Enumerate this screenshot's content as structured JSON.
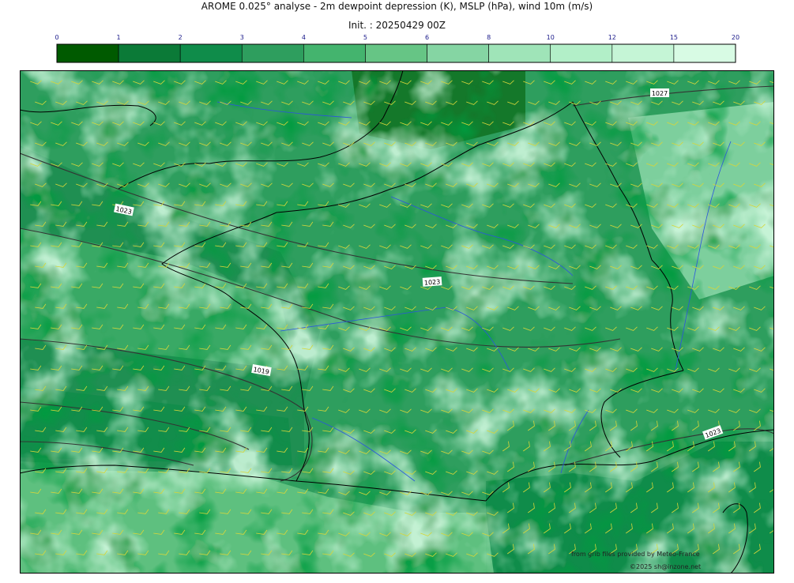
{
  "header": {
    "title": "AROME 0.025° analyse - 2m dewpoint depression (K), MSLP (hPa), wind 10m (m/s)",
    "init": "Init. : 20250429 00Z"
  },
  "colorbar": {
    "ticks": [
      "0",
      "1",
      "2",
      "3",
      "4",
      "5",
      "6",
      "8",
      "10",
      "12",
      "15",
      "20"
    ],
    "colors": [
      "#005a00",
      "#0b7a37",
      "#0f8c4a",
      "#2e9e5e",
      "#44b46e",
      "#66c585",
      "#85d5a3",
      "#9fe4b8",
      "#b2efc8",
      "#c5f5d6",
      "#d8fbe4"
    ]
  },
  "map": {
    "isobar_labels": [
      "1023",
      "1023",
      "1019",
      "1027",
      "1023"
    ],
    "colors": {
      "coast": "#000000",
      "rivers": "#2a55dd",
      "isobars": "#333333",
      "wind_barbs": "#d6d63a"
    }
  },
  "credits": {
    "grib": "from grib files provided by Meteo-France",
    "site": "©2025 sh@inzone.net"
  }
}
